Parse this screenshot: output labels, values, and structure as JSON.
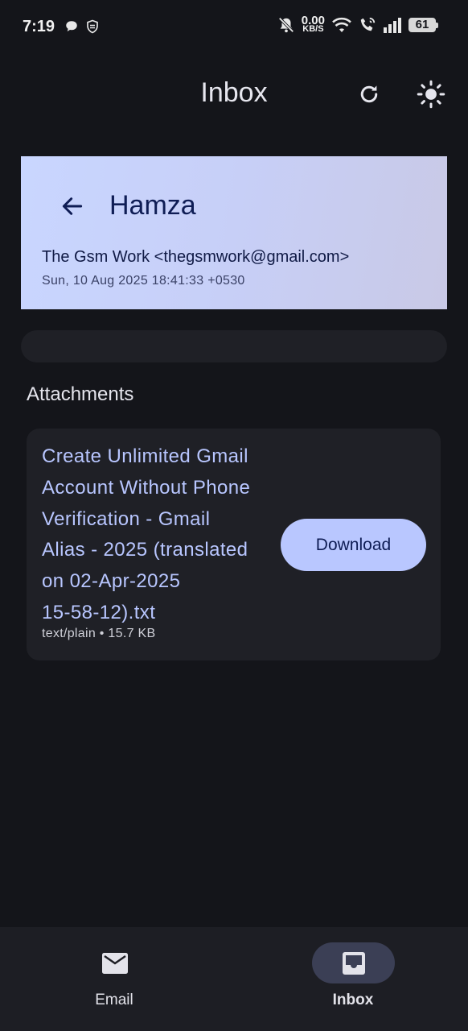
{
  "status_bar": {
    "time": "7:19",
    "net_speed_value": "0.00",
    "net_speed_unit": "KB/S",
    "battery": "61"
  },
  "header": {
    "title": "Inbox",
    "refresh_icon": "refresh-icon",
    "theme_icon": "sun-icon"
  },
  "email": {
    "back_icon": "arrow-left-icon",
    "subject": "Hamza",
    "from": "The Gsm Work <thegsmwork@gmail.com>",
    "date": "Sun, 10 Aug 2025 18:41:33 +0530"
  },
  "attachments": {
    "heading": "Attachments",
    "items": [
      {
        "name": "Create Unlimited Gmail Account Without Phone Verification  - Gmail Alias - 2025 (translated on 02-Apr-2025 15-58-12).txt",
        "name_lines": [
          "Create Unlimited Gmail",
          "Account Without Phone",
          "Verification  - Gmail",
          "Alias - 2025 (translated",
          "on 02-Apr-2025",
          "15-58-12).txt"
        ],
        "meta": "text/plain • 15.7 KB",
        "download_label": "Download"
      }
    ]
  },
  "bottom_nav": {
    "items": [
      {
        "label": "Email",
        "icon": "mail-icon",
        "selected": false
      },
      {
        "label": "Inbox",
        "icon": "inbox-icon",
        "selected": true
      }
    ]
  },
  "colors": {
    "background": "#14151a",
    "card_gradient_start": "#c9d6ff",
    "accent": "#b9c7ff",
    "link_text": "#b8c6ff"
  }
}
